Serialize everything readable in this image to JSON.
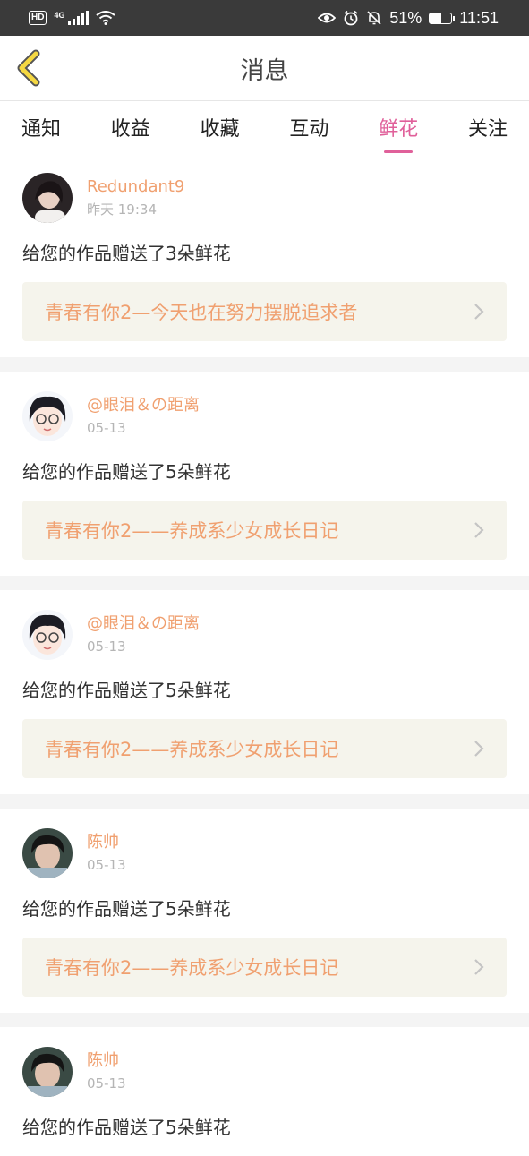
{
  "status_bar": {
    "hd": "HD",
    "network": "4G",
    "battery_percent": "51%",
    "battery_level": 0.51,
    "time": "11:51"
  },
  "header": {
    "title": "消息"
  },
  "tabs": [
    {
      "label": "通知",
      "active": false
    },
    {
      "label": "收益",
      "active": false
    },
    {
      "label": "收藏",
      "active": false
    },
    {
      "label": "互动",
      "active": false
    },
    {
      "label": "鲜花",
      "active": true
    },
    {
      "label": "关注",
      "active": false
    }
  ],
  "items": [
    {
      "user": "Redundant9",
      "time": "昨天 19:34",
      "message": "给您的作品赠送了3朵鲜花",
      "work": "青春有你2—今天也在努力摆脱追求者"
    },
    {
      "user": "@眼泪＆の距离",
      "time": "05-13",
      "message": "给您的作品赠送了5朵鲜花",
      "work": "青春有你2——养成系少女成长日记"
    },
    {
      "user": "@眼泪＆の距离",
      "time": "05-13",
      "message": "给您的作品赠送了5朵鲜花",
      "work": "青春有你2——养成系少女成长日记"
    },
    {
      "user": "陈帅",
      "time": "05-13",
      "message": "给您的作品赠送了5朵鲜花",
      "work": "青春有你2——养成系少女成长日记"
    },
    {
      "user": "陈帅",
      "time": "05-13",
      "message": "给您的作品赠送了5朵鲜花",
      "work": ""
    }
  ],
  "colors": {
    "accent": "#e0609a",
    "name": "#f0a070",
    "back_arrow": "#f5d842"
  }
}
